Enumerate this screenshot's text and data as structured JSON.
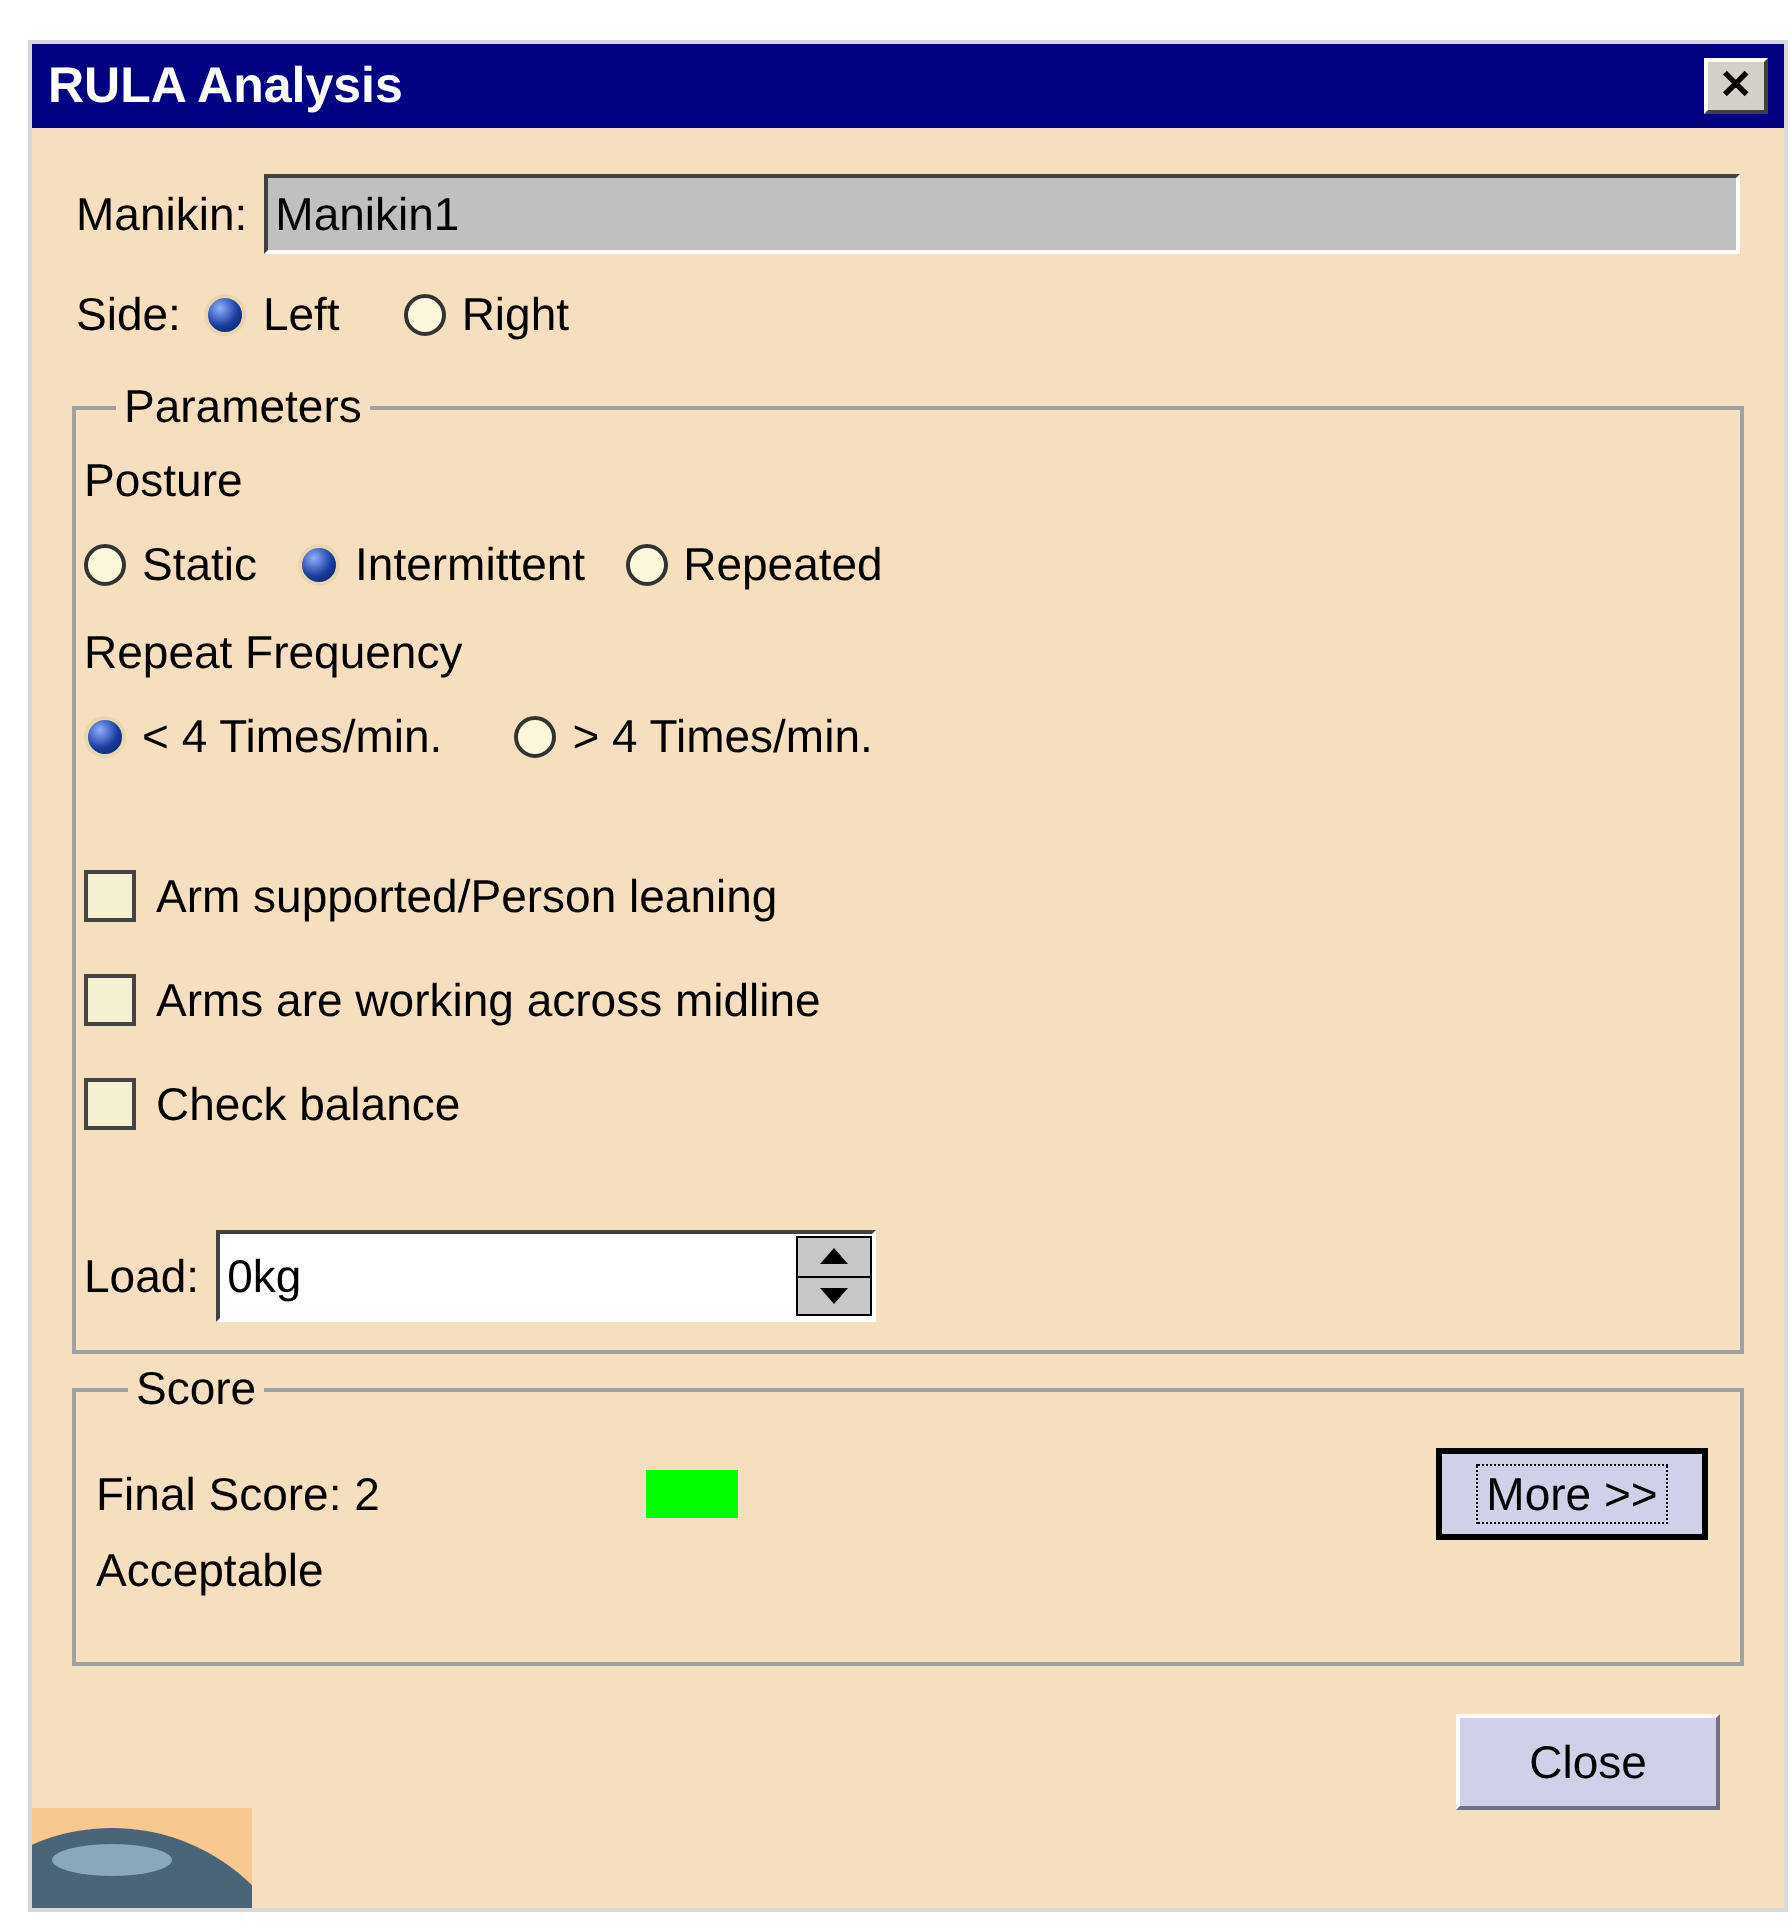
{
  "window": {
    "title": "RULA Analysis",
    "close": "✕"
  },
  "manikin": {
    "label": "Manikin:",
    "value": "Manikin1"
  },
  "side": {
    "label": "Side:",
    "options": [
      {
        "label": "Left",
        "selected": true
      },
      {
        "label": "Right",
        "selected": false
      }
    ]
  },
  "parameters": {
    "title": "Parameters",
    "posture": {
      "label": "Posture",
      "options": [
        {
          "label": "Static",
          "selected": false
        },
        {
          "label": "Intermittent",
          "selected": true
        },
        {
          "label": "Repeated",
          "selected": false
        }
      ]
    },
    "repeat_frequency": {
      "label": "Repeat Frequency",
      "options": [
        {
          "label": "< 4 Times/min.",
          "selected": true
        },
        {
          "label": "> 4 Times/min.",
          "selected": false
        }
      ]
    },
    "checks": [
      {
        "label": "Arm supported/Person leaning",
        "checked": false
      },
      {
        "label": "Arms are working across midline",
        "checked": false
      },
      {
        "label": "Check balance",
        "checked": false
      }
    ],
    "load": {
      "label": "Load:",
      "value": "0kg"
    }
  },
  "score": {
    "title": "Score",
    "final_score": "Final Score: 2",
    "color": "#00ff00",
    "verdict": "Acceptable",
    "more_button": "More >>"
  },
  "buttons": [
    "Close"
  ]
}
